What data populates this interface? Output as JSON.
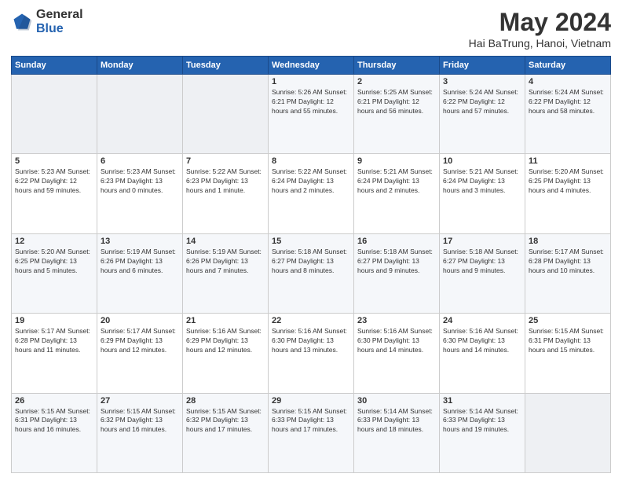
{
  "header": {
    "logo_general": "General",
    "logo_blue": "Blue",
    "title": "May 2024",
    "subtitle": "Hai BaTrung, Hanoi, Vietnam"
  },
  "weekdays": [
    "Sunday",
    "Monday",
    "Tuesday",
    "Wednesday",
    "Thursday",
    "Friday",
    "Saturday"
  ],
  "weeks": [
    [
      {
        "day": "",
        "info": ""
      },
      {
        "day": "",
        "info": ""
      },
      {
        "day": "",
        "info": ""
      },
      {
        "day": "1",
        "info": "Sunrise: 5:26 AM\nSunset: 6:21 PM\nDaylight: 12 hours\nand 55 minutes."
      },
      {
        "day": "2",
        "info": "Sunrise: 5:25 AM\nSunset: 6:21 PM\nDaylight: 12 hours\nand 56 minutes."
      },
      {
        "day": "3",
        "info": "Sunrise: 5:24 AM\nSunset: 6:22 PM\nDaylight: 12 hours\nand 57 minutes."
      },
      {
        "day": "4",
        "info": "Sunrise: 5:24 AM\nSunset: 6:22 PM\nDaylight: 12 hours\nand 58 minutes."
      }
    ],
    [
      {
        "day": "5",
        "info": "Sunrise: 5:23 AM\nSunset: 6:22 PM\nDaylight: 12 hours\nand 59 minutes."
      },
      {
        "day": "6",
        "info": "Sunrise: 5:23 AM\nSunset: 6:23 PM\nDaylight: 13 hours\nand 0 minutes."
      },
      {
        "day": "7",
        "info": "Sunrise: 5:22 AM\nSunset: 6:23 PM\nDaylight: 13 hours\nand 1 minute."
      },
      {
        "day": "8",
        "info": "Sunrise: 5:22 AM\nSunset: 6:24 PM\nDaylight: 13 hours\nand 2 minutes."
      },
      {
        "day": "9",
        "info": "Sunrise: 5:21 AM\nSunset: 6:24 PM\nDaylight: 13 hours\nand 2 minutes."
      },
      {
        "day": "10",
        "info": "Sunrise: 5:21 AM\nSunset: 6:24 PM\nDaylight: 13 hours\nand 3 minutes."
      },
      {
        "day": "11",
        "info": "Sunrise: 5:20 AM\nSunset: 6:25 PM\nDaylight: 13 hours\nand 4 minutes."
      }
    ],
    [
      {
        "day": "12",
        "info": "Sunrise: 5:20 AM\nSunset: 6:25 PM\nDaylight: 13 hours\nand 5 minutes."
      },
      {
        "day": "13",
        "info": "Sunrise: 5:19 AM\nSunset: 6:26 PM\nDaylight: 13 hours\nand 6 minutes."
      },
      {
        "day": "14",
        "info": "Sunrise: 5:19 AM\nSunset: 6:26 PM\nDaylight: 13 hours\nand 7 minutes."
      },
      {
        "day": "15",
        "info": "Sunrise: 5:18 AM\nSunset: 6:27 PM\nDaylight: 13 hours\nand 8 minutes."
      },
      {
        "day": "16",
        "info": "Sunrise: 5:18 AM\nSunset: 6:27 PM\nDaylight: 13 hours\nand 9 minutes."
      },
      {
        "day": "17",
        "info": "Sunrise: 5:18 AM\nSunset: 6:27 PM\nDaylight: 13 hours\nand 9 minutes."
      },
      {
        "day": "18",
        "info": "Sunrise: 5:17 AM\nSunset: 6:28 PM\nDaylight: 13 hours\nand 10 minutes."
      }
    ],
    [
      {
        "day": "19",
        "info": "Sunrise: 5:17 AM\nSunset: 6:28 PM\nDaylight: 13 hours\nand 11 minutes."
      },
      {
        "day": "20",
        "info": "Sunrise: 5:17 AM\nSunset: 6:29 PM\nDaylight: 13 hours\nand 12 minutes."
      },
      {
        "day": "21",
        "info": "Sunrise: 5:16 AM\nSunset: 6:29 PM\nDaylight: 13 hours\nand 12 minutes."
      },
      {
        "day": "22",
        "info": "Sunrise: 5:16 AM\nSunset: 6:30 PM\nDaylight: 13 hours\nand 13 minutes."
      },
      {
        "day": "23",
        "info": "Sunrise: 5:16 AM\nSunset: 6:30 PM\nDaylight: 13 hours\nand 14 minutes."
      },
      {
        "day": "24",
        "info": "Sunrise: 5:16 AM\nSunset: 6:30 PM\nDaylight: 13 hours\nand 14 minutes."
      },
      {
        "day": "25",
        "info": "Sunrise: 5:15 AM\nSunset: 6:31 PM\nDaylight: 13 hours\nand 15 minutes."
      }
    ],
    [
      {
        "day": "26",
        "info": "Sunrise: 5:15 AM\nSunset: 6:31 PM\nDaylight: 13 hours\nand 16 minutes."
      },
      {
        "day": "27",
        "info": "Sunrise: 5:15 AM\nSunset: 6:32 PM\nDaylight: 13 hours\nand 16 minutes."
      },
      {
        "day": "28",
        "info": "Sunrise: 5:15 AM\nSunset: 6:32 PM\nDaylight: 13 hours\nand 17 minutes."
      },
      {
        "day": "29",
        "info": "Sunrise: 5:15 AM\nSunset: 6:33 PM\nDaylight: 13 hours\nand 17 minutes."
      },
      {
        "day": "30",
        "info": "Sunrise: 5:14 AM\nSunset: 6:33 PM\nDaylight: 13 hours\nand 18 minutes."
      },
      {
        "day": "31",
        "info": "Sunrise: 5:14 AM\nSunset: 6:33 PM\nDaylight: 13 hours\nand 19 minutes."
      },
      {
        "day": "",
        "info": ""
      }
    ]
  ]
}
